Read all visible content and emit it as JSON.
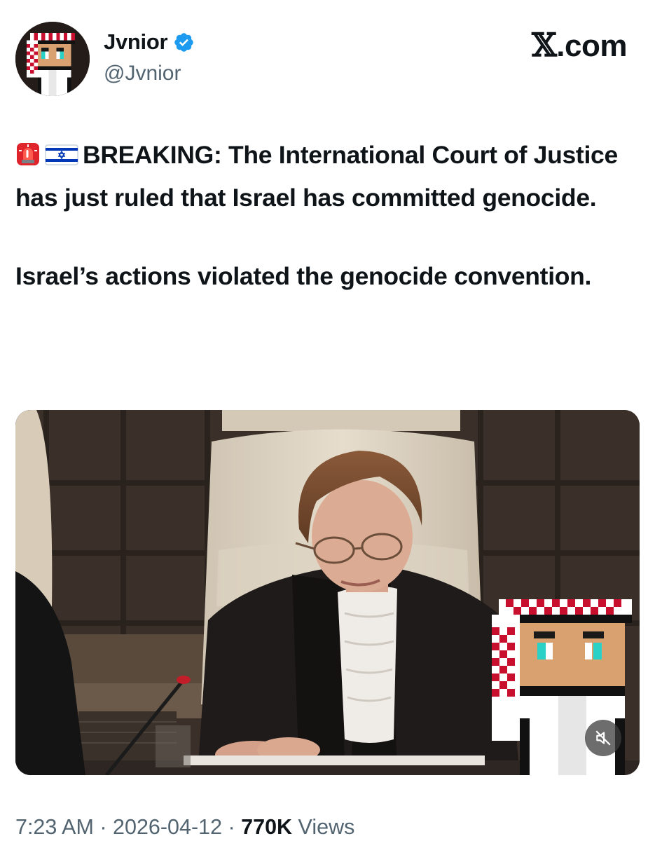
{
  "author": {
    "display_name": "Jvnior",
    "handle": "@Jvnior",
    "verified_icon": "verified-badge-icon",
    "avatar": "pixel-art-avatar"
  },
  "brand": {
    "x_mark": "𝕏",
    "suffix": ".com"
  },
  "tweet": {
    "emojis": [
      "rotating-light-icon",
      "israel-flag-icon"
    ],
    "paragraph_1": "BREAKING: The International Court of Justice has just ruled that Israel has committed genocide.",
    "paragraph_2": "Israel’s actions violated the genocide convention."
  },
  "media": {
    "type": "video",
    "mute_icon": "muted-speaker-icon"
  },
  "meta": {
    "time": "7:23 AM",
    "separator": " · ",
    "date": "2026-04-12",
    "views_count": "770K",
    "views_label": "Views"
  },
  "colors": {
    "verified": "#1d9bf0",
    "secondary_text": "#536471",
    "primary_text": "#0f1419"
  }
}
